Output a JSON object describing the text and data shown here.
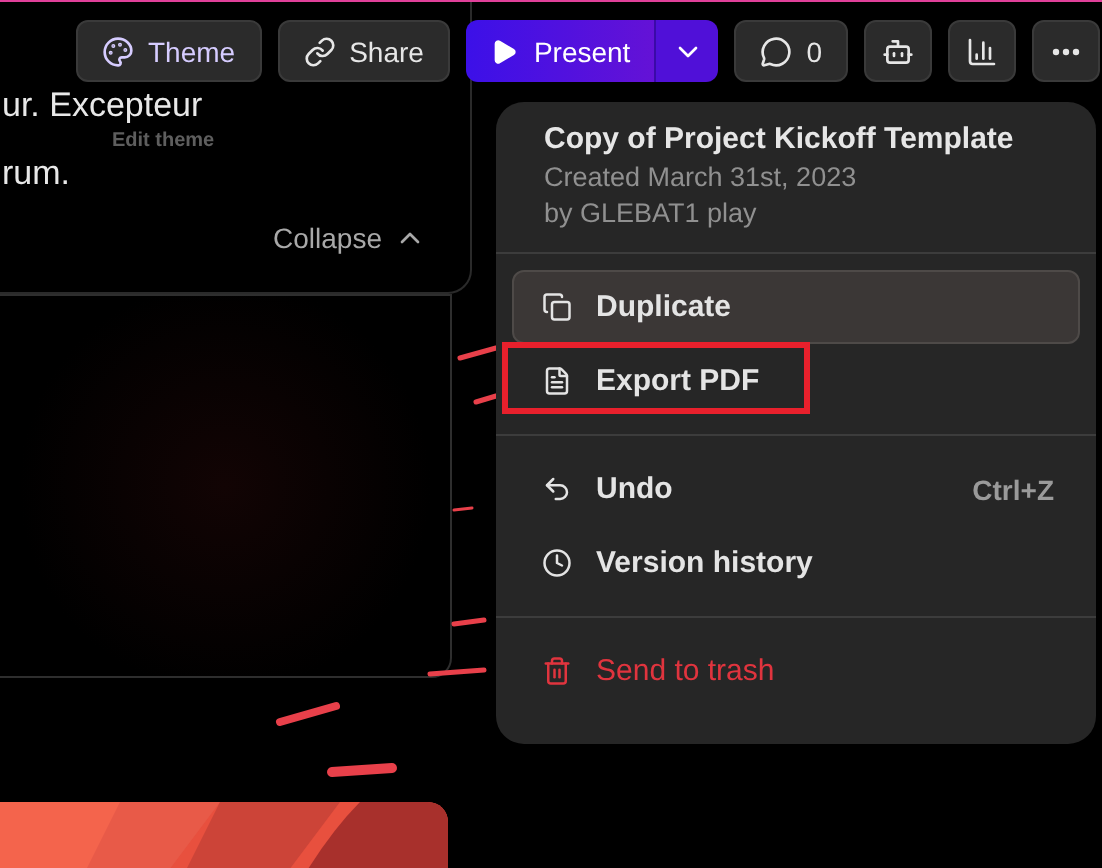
{
  "slide_text": {
    "lines": [
      "ur. Excepteur",
      "rum."
    ],
    "collapse": "Collapse"
  },
  "tooltip": "Edit theme",
  "toolbar": {
    "buttons": [
      {
        "kind": "theme",
        "label": "Theme"
      },
      {
        "kind": "share",
        "label": "Share"
      },
      {
        "kind": "present",
        "label": "Present"
      },
      {
        "kind": "comments",
        "label": "0"
      },
      {
        "kind": "avatar"
      },
      {
        "kind": "analytics"
      },
      {
        "kind": "more"
      }
    ]
  },
  "menu": {
    "title": "Copy of Project Kickoff Template",
    "created": "Created March 31st, 2023",
    "author": "by GLEBAT1 play",
    "groups": [
      [
        {
          "kind": "duplicate",
          "label": "Duplicate",
          "highlighted": true,
          "outlined": false,
          "danger": false
        },
        {
          "kind": "export",
          "label": "Export PDF",
          "highlighted": false,
          "outlined": true,
          "danger": false
        }
      ],
      [
        {
          "kind": "undo",
          "label": "Undo",
          "shortcut": "Ctrl+Z",
          "highlighted": false,
          "outlined": false,
          "danger": false
        },
        {
          "kind": "history",
          "label": "Version history",
          "highlighted": false,
          "outlined": false,
          "danger": false
        }
      ],
      [
        {
          "kind": "trash",
          "label": "Send to trash",
          "danger": true,
          "highlighted": false,
          "outlined": false
        }
      ]
    ]
  }
}
